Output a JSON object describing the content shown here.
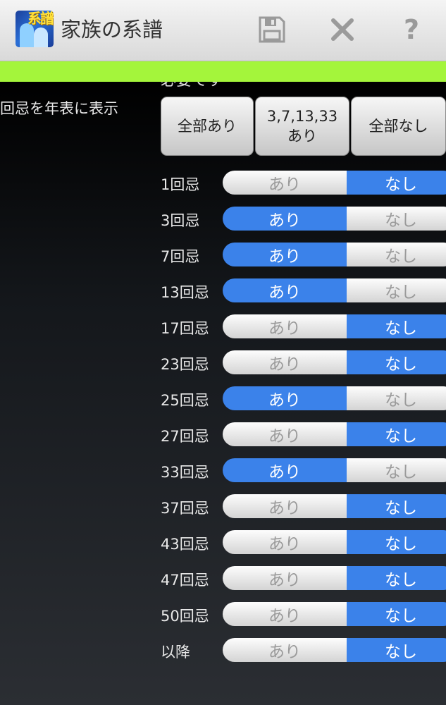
{
  "appbar": {
    "icon_text": "系譜",
    "title": "家族の系譜",
    "actions": [
      {
        "name": "save",
        "icon": "floppy-disk-icon"
      },
      {
        "name": "close",
        "icon": "x-icon"
      },
      {
        "name": "help",
        "icon": "question-mark-icon",
        "glyph": "?"
      }
    ]
  },
  "colors": {
    "accent_bar": "#a4f53b",
    "toggle_selected": "#3b82ea",
    "toggle_unselected": "#d9d9d9"
  },
  "section": {
    "top_text": "必要です",
    "label": "回忌を年表に表示",
    "presets": [
      "全部あり",
      "3,7,13,33\nあり",
      "全部なし"
    ]
  },
  "toggle_labels": {
    "on": "あり",
    "off": "なし"
  },
  "rows": [
    {
      "label": "1回忌",
      "on": false
    },
    {
      "label": "3回忌",
      "on": true
    },
    {
      "label": "7回忌",
      "on": true
    },
    {
      "label": "13回忌",
      "on": true
    },
    {
      "label": "17回忌",
      "on": false
    },
    {
      "label": "23回忌",
      "on": false
    },
    {
      "label": "25回忌",
      "on": true
    },
    {
      "label": "27回忌",
      "on": false
    },
    {
      "label": "33回忌",
      "on": true
    },
    {
      "label": "37回忌",
      "on": false
    },
    {
      "label": "43回忌",
      "on": false
    },
    {
      "label": "47回忌",
      "on": false
    },
    {
      "label": "50回忌",
      "on": false
    },
    {
      "label": "以降",
      "on": false
    }
  ]
}
